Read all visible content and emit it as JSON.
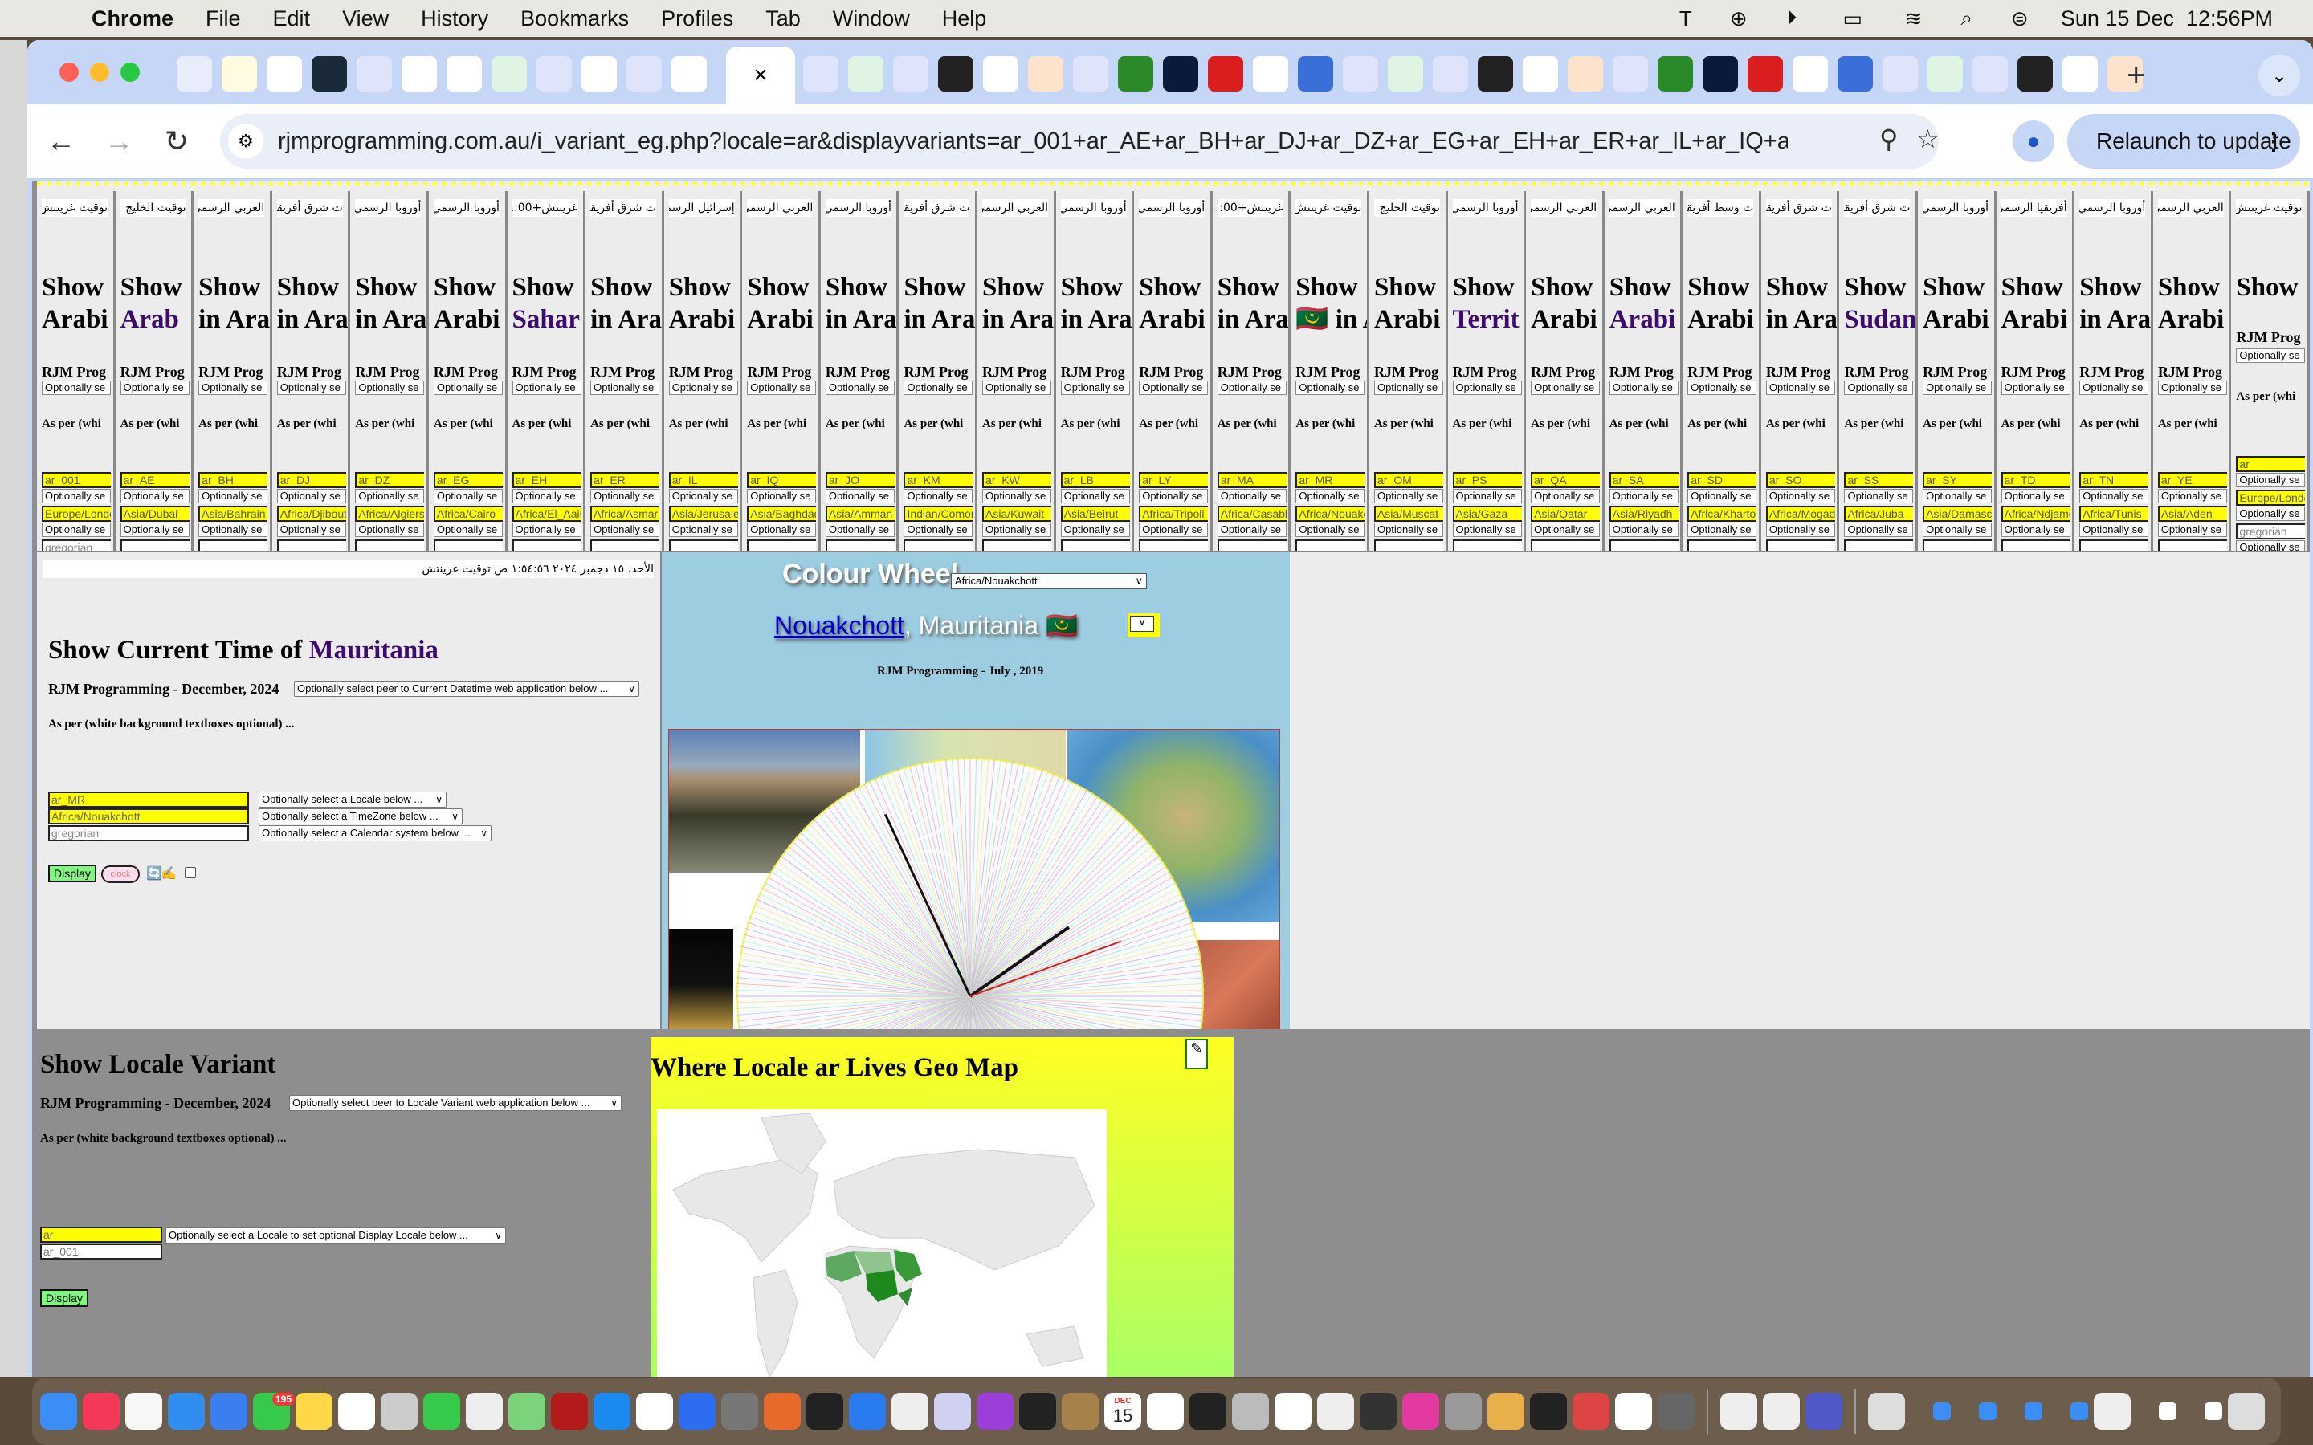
{
  "menubar": {
    "apple_icon": "apple-logo",
    "app_name": "Chrome",
    "items": [
      "File",
      "Edit",
      "View",
      "History",
      "Bookmarks",
      "Profiles",
      "Tab",
      "Window",
      "Help"
    ],
    "status_icons": [
      "teams-icon",
      "network-download-icon",
      "play-icon",
      "battery-icon",
      "wifi-icon",
      "spotlight-search-icon",
      "control-center-icon"
    ],
    "datetime": "Sun 15 Dec  12:56PM"
  },
  "browser": {
    "active_tab_close": "×",
    "new_tab": "+",
    "tab_menu": "⌄",
    "url": "rjmprogramming.com.au/i_variant_eg.php?locale=ar&displayvariants=ar_001+ar_AE+ar_BH+ar_DJ+ar_DZ+ar_EG+ar_EH+ar_ER+ar_IL+ar_IQ+ar_...",
    "relaunch_label": "Relaunch to update"
  },
  "variant_columns": [
    {
      "locale": "ar_001",
      "tz_text": "توقيت غرينتش",
      "heading1": "Show",
      "heading2": "Arabi",
      "heading2_colored": false,
      "timezone": "Europe/London",
      "calendar": "gregorian"
    },
    {
      "locale": "ar_AE",
      "tz_text": "توقيت الخليج",
      "heading1": "Show",
      "heading2": "Arab",
      "heading2_colored": true,
      "timezone": "Asia/Dubai"
    },
    {
      "locale": "ar_BH",
      "tz_text": "العربي الرسمي",
      "heading1": "Show",
      "heading2": "in Ara",
      "heading2_colored": false,
      "timezone": "Asia/Bahrain"
    },
    {
      "locale": "ar_DJ",
      "tz_text": "ت شرق أفريقيا",
      "heading1": "Show",
      "heading2": "in Ara",
      "heading2_colored": false,
      "timezone": "Africa/Djibouti"
    },
    {
      "locale": "ar_DZ",
      "tz_text": "أوروبا الرسمي",
      "heading1": "Show",
      "heading2": "in Ara",
      "heading2_colored": false,
      "timezone": "Africa/Algiers"
    },
    {
      "locale": "ar_EG",
      "tz_text": "أوروبا الرسمي",
      "heading1": "Show",
      "heading2": "Arabi",
      "heading2_colored": false,
      "timezone": "Africa/Cairo"
    },
    {
      "locale": "ar_EH",
      "tz_text": "غرينتش+01:00",
      "heading1": "Show",
      "heading2": "Sahar",
      "heading2_colored": true,
      "timezone": "Africa/El_Aaiun"
    },
    {
      "locale": "ar_ER",
      "tz_text": "ت شرق أفريقيا",
      "heading1": "Show",
      "heading2": "in Ara",
      "heading2_colored": false,
      "timezone": "Africa/Asmara"
    },
    {
      "locale": "ar_IL",
      "tz_text": "إسرائيل الرسمي",
      "heading1": "Show",
      "heading2": "Arabi",
      "heading2_colored": false,
      "timezone": "Asia/Jerusalem"
    },
    {
      "locale": "ar_IQ",
      "tz_text": "العربي الرسمي",
      "heading1": "Show",
      "heading2": "Arabi",
      "heading2_colored": false,
      "timezone": "Asia/Baghdad"
    },
    {
      "locale": "ar_JO",
      "tz_text": "أوروبا الرسمي",
      "heading1": "Show",
      "heading2": "in Ara",
      "heading2_colored": false,
      "timezone": "Asia/Amman"
    },
    {
      "locale": "ar_KM",
      "tz_text": "ت شرق أفريقيا",
      "heading1": "Show",
      "heading2": "in Ara",
      "heading2_colored": false,
      "timezone": "Indian/Comoro"
    },
    {
      "locale": "ar_KW",
      "tz_text": "العربي الرسمي",
      "heading1": "Show",
      "heading2": "in Ara",
      "heading2_colored": false,
      "timezone": "Asia/Kuwait"
    },
    {
      "locale": "ar_LB",
      "tz_text": "أوروبا الرسمي",
      "heading1": "Show",
      "heading2": "in Ara",
      "heading2_colored": false,
      "timezone": "Asia/Beirut"
    },
    {
      "locale": "ar_LY",
      "tz_text": "أوروبا الرسمي",
      "heading1": "Show",
      "heading2": "Arabi",
      "heading2_colored": false,
      "timezone": "Africa/Tripoli"
    },
    {
      "locale": "ar_MA",
      "tz_text": "غرينتش+01:00",
      "heading1": "Show",
      "heading2": "in Ara",
      "heading2_colored": false,
      "timezone": "Africa/Casablanca"
    },
    {
      "locale": "ar_MR",
      "tz_text": "توقيت غرينتش",
      "heading1": "Show",
      "heading2": "🇲🇷 in A",
      "heading2_colored": false,
      "timezone": "Africa/Nouakchott"
    },
    {
      "locale": "ar_OM",
      "tz_text": "توقيت الخليج",
      "heading1": "Show",
      "heading2": "Arabi",
      "heading2_colored": false,
      "timezone": "Asia/Muscat"
    },
    {
      "locale": "ar_PS",
      "tz_text": "أوروبا الرسمي",
      "heading1": "Show",
      "heading2": "Territ",
      "heading2_colored": true,
      "timezone": "Asia/Gaza"
    },
    {
      "locale": "ar_QA",
      "tz_text": "العربي الرسمي",
      "heading1": "Show",
      "heading2": "Arabi",
      "heading2_colored": false,
      "timezone": "Asia/Qatar"
    },
    {
      "locale": "ar_SA",
      "tz_text": "العربي الرسمي",
      "heading1": "Show",
      "heading2": "Arabi",
      "heading2_colored": true,
      "timezone": "Asia/Riyadh"
    },
    {
      "locale": "ar_SD",
      "tz_text": "ت وسط أفريقيا",
      "heading1": "Show",
      "heading2": "Arabi",
      "heading2_colored": false,
      "timezone": "Africa/Khartoum"
    },
    {
      "locale": "ar_SO",
      "tz_text": "ت شرق أفريقيا",
      "heading1": "Show",
      "heading2": "in Ara",
      "heading2_colored": false,
      "timezone": "Africa/Mogadishu"
    },
    {
      "locale": "ar_SS",
      "tz_text": "ت شرق أفريقيا",
      "heading1": "Show",
      "heading2": "Sudan",
      "heading2_colored": true,
      "timezone": "Africa/Juba"
    },
    {
      "locale": "ar_SY",
      "tz_text": "أوروبا الرسمي",
      "heading1": "Show",
      "heading2": "Arabi",
      "heading2_colored": false,
      "timezone": "Asia/Damascus"
    },
    {
      "locale": "ar_TD",
      "tz_text": "أفريقيا الرسمي",
      "heading1": "Show",
      "heading2": "Arabi",
      "heading2_colored": false,
      "timezone": "Africa/Ndjamena"
    },
    {
      "locale": "ar_TN",
      "tz_text": "أوروبا الرسمي",
      "heading1": "Show",
      "heading2": "in Ara",
      "heading2_colored": false,
      "timezone": "Africa/Tunis"
    },
    {
      "locale": "ar_YE",
      "tz_text": "العربي الرسمي",
      "heading1": "Show",
      "heading2": "Arabi",
      "heading2_colored": false,
      "timezone": "Asia/Aden"
    },
    {
      "locale": "ar",
      "tz_text": "توقيت غرينتش",
      "heading1": "Show",
      "heading2": "",
      "heading2_colored": false,
      "timezone": "Europe/London",
      "calendar": "gregorian"
    }
  ],
  "column_common": {
    "rjm": "RJM Prog",
    "select_label": "Optionally se",
    "asper": "As per (whi"
  },
  "current_time": {
    "datetime_arabic": "الأحد، ١٥ دجمبر ٢٠٢٤ ١:٥٤:٥٦ ص توقيت غرينتش",
    "title_prefix": "Show Current Time of ",
    "title_country": "Mauritania",
    "subtitle": "RJM Programming - December, 2024",
    "peer_select": "Optionally select peer to Current Datetime web application below ...",
    "asper": "As per (white background textboxes optional) ...",
    "locale_value": "ar_MR",
    "locale_select": "Optionally select a Locale below ...",
    "timezone_value": "Africa/Nouakchott",
    "timezone_select": "Optionally select a TimeZone below ...",
    "calendar_placeholder": "gregorian",
    "calendar_select": "Optionally select a Calendar system below ...",
    "display_button": "Display",
    "clock_button": "clock"
  },
  "colour_wheel": {
    "title": "Colour Wheel",
    "timezone_select": "Africa/Nouakchott",
    "city_link": "Nouakchott",
    "city_rest": ", Mauritania 🇲🇷",
    "credit": "RJM Programming - July , 2019",
    "clock": {
      "hour_angle_deg": 55,
      "minute_angle_deg": 335,
      "second_angle_deg": 70
    }
  },
  "locale_variant": {
    "title": "Show Locale Variant",
    "subtitle": "RJM Programming - December, 2024",
    "peer_select": "Optionally select peer to Locale Variant web application below ...",
    "asper": "As per (white background textboxes optional) ...",
    "locale_value": "ar",
    "display_locale_placeholder": "ar_001",
    "display_locale_select": "Optionally select a Locale to set optional Display Locale below ...",
    "display_button": "Display"
  },
  "geo_map": {
    "title": "Where Locale ar Lives Geo Map",
    "highlight_color": "#2e8b2e"
  },
  "dock": {
    "apps": [
      "finder",
      "music",
      "reminders",
      "safari",
      "mail",
      "messages",
      "notes",
      "freeform",
      "launchpad",
      "facetime",
      "file",
      "maps",
      "filezilla",
      "app-store",
      "news",
      "zoom",
      "gimp",
      "firefox",
      "apple-tv",
      "xcode",
      "preview",
      "bbedit",
      "podcasts",
      "terminal-exec",
      "contacts",
      "calendar",
      "opera",
      "terminal",
      "calculator",
      "chrome",
      "file",
      "quicktime",
      "intellij",
      "system-settings",
      "paint",
      "terminal-exec",
      "cabri",
      "inkscape",
      "tableplus",
      "script-editor",
      "textedit",
      "teams",
      "archive",
      "finder-window",
      "finder-window",
      "finder-window",
      "finder-window",
      "screenshot",
      "calendar-mini",
      "chrome-mini",
      "trash"
    ],
    "messages_badge": "195",
    "calendar_month": "DEC",
    "calendar_day": "15"
  }
}
